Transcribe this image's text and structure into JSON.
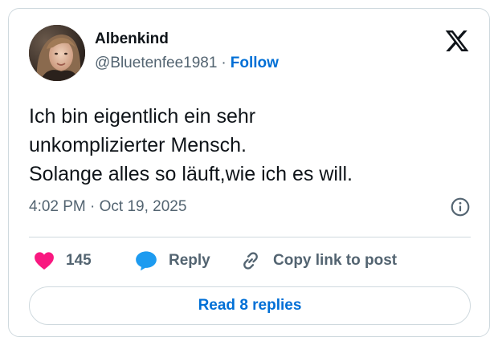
{
  "author": {
    "display_name": "Albenkind",
    "handle": "@Bluetenfee1981",
    "separator": "·",
    "follow_label": "Follow"
  },
  "tweet": {
    "lines": [
      "Ich bin eigentlich ein sehr",
      "unkomplizierter Mensch.",
      "Solange alles so läuft,wie ich es will."
    ],
    "timestamp": "4:02 PM · Oct 19, 2025"
  },
  "actions": {
    "like_count": "145",
    "reply_label": "Reply",
    "copy_label": "Copy link to post"
  },
  "replies_button": {
    "label": "Read 8 replies"
  },
  "icons": {
    "logo": "x-logo-icon",
    "info": "info-icon",
    "like": "heart-icon",
    "reply": "speech-bubble-icon",
    "copy": "link-icon"
  },
  "colors": {
    "link_blue": "#006fd6",
    "heart": "#f91880",
    "reply_bubble": "#1d9bf0",
    "muted_text": "#536471",
    "border": "#cfd9de"
  }
}
